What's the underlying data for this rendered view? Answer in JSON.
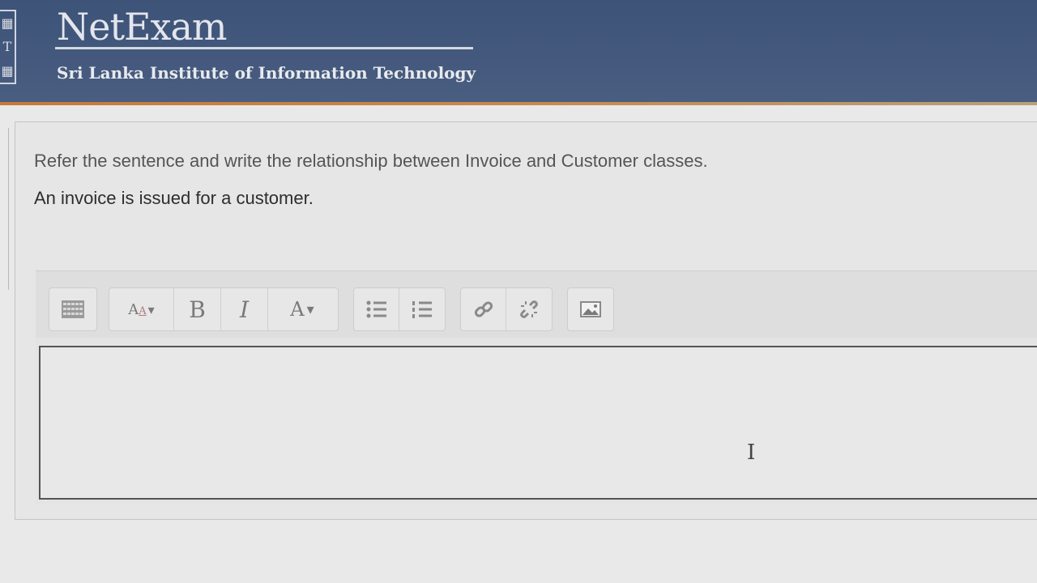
{
  "header": {
    "brand_name": "NetExam",
    "institute_name": "Sri Lanka Institute of Information Technology",
    "logo_letter": "T"
  },
  "question": {
    "instruction": "Refer the sentence and write the relationship between Invoice and Customer classes.",
    "sentence": "An invoice is issued for a customer."
  },
  "toolbar": {
    "font_size_label": "A",
    "bold_label": "B",
    "italic_label": "I",
    "font_color_label": "A",
    "dropdown_glyph": "▾",
    "icons": [
      "toggle-toolbar-icon",
      "font-size-icon",
      "bold-icon",
      "italic-icon",
      "font-color-icon",
      "unordered-list-icon",
      "ordered-list-icon",
      "link-icon",
      "unlink-icon",
      "image-icon"
    ]
  },
  "editor": {
    "value": ""
  },
  "colors": {
    "header_bg": "#44597d",
    "header_accent": "#c8894b",
    "page_bg": "#e9e9e9"
  }
}
